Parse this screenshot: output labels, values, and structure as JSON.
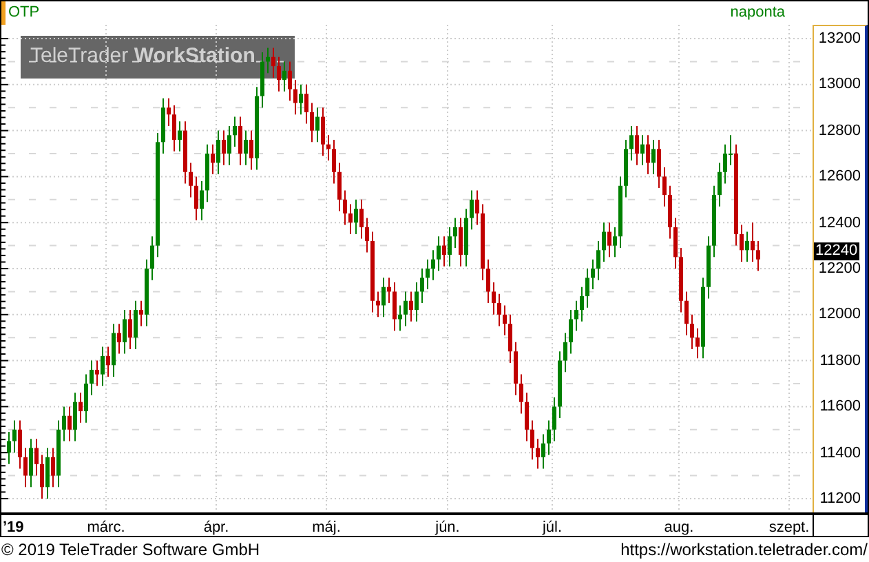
{
  "header": {
    "symbol": "OTP",
    "period": "naponta"
  },
  "watermark": {
    "brand": "TeleTrader",
    "product": "WorkStation"
  },
  "chart": {
    "current_price": "12240",
    "chart_data": {
      "type": "candlestick",
      "grid": true,
      "ylim": [
        11140,
        13260
      ],
      "yticks": [
        13200,
        13000,
        12800,
        12600,
        12400,
        12200,
        12000,
        11800,
        11600,
        11400,
        11200
      ],
      "categories": [
        "’19",
        null,
        null,
        null,
        null,
        null,
        null,
        null,
        null,
        null,
        null,
        null,
        null,
        null,
        null,
        null,
        null,
        null,
        "márc.",
        null,
        null,
        null,
        null,
        null,
        null,
        null,
        null,
        null,
        null,
        null,
        null,
        null,
        null,
        null,
        null,
        null,
        null,
        null,
        "ápr.",
        null,
        null,
        null,
        null,
        null,
        null,
        null,
        null,
        null,
        null,
        null,
        null,
        null,
        null,
        null,
        null,
        null,
        null,
        null,
        "máj.",
        null,
        null,
        null,
        null,
        null,
        null,
        null,
        null,
        null,
        null,
        null,
        null,
        null,
        null,
        null,
        null,
        null,
        null,
        null,
        null,
        null,
        "jún.",
        null,
        null,
        null,
        null,
        null,
        null,
        null,
        null,
        null,
        null,
        null,
        null,
        null,
        null,
        null,
        null,
        null,
        null,
        "júl.",
        null,
        null,
        null,
        null,
        null,
        null,
        null,
        null,
        null,
        null,
        null,
        null,
        null,
        null,
        null,
        null,
        null,
        null,
        null,
        null,
        null,
        null,
        "aug.",
        null,
        null,
        null,
        null,
        null,
        null,
        null,
        null,
        null,
        null,
        null,
        null,
        null,
        null,
        null,
        null,
        null,
        null,
        null,
        "szept."
      ],
      "ohlc": [
        [
          11400,
          11490,
          11350,
          11450
        ],
        [
          11450,
          11540,
          11400,
          11500
        ],
        [
          11500,
          11540,
          11330,
          11380
        ],
        [
          11380,
          11420,
          11250,
          11300
        ],
        [
          11300,
          11460,
          11250,
          11420
        ],
        [
          11420,
          11460,
          11300,
          11350
        ],
        [
          11350,
          11390,
          11200,
          11250
        ],
        [
          11250,
          11420,
          11200,
          11380
        ],
        [
          11380,
          11420,
          11250,
          11300
        ],
        [
          11300,
          11540,
          11250,
          11500
        ],
        [
          11500,
          11600,
          11450,
          11560
        ],
        [
          11560,
          11600,
          11450,
          11500
        ],
        [
          11500,
          11660,
          11450,
          11620
        ],
        [
          11620,
          11660,
          11530,
          11580
        ],
        [
          11580,
          11740,
          11530,
          11700
        ],
        [
          11700,
          11800,
          11650,
          11760
        ],
        [
          11760,
          11800,
          11690,
          11740
        ],
        [
          11740,
          11860,
          11690,
          11820
        ],
        [
          11820,
          11860,
          11730,
          11780
        ],
        [
          11780,
          11960,
          11730,
          11920
        ],
        [
          11920,
          11960,
          11830,
          11880
        ],
        [
          11880,
          12020,
          11830,
          11980
        ],
        [
          11980,
          12020,
          11850,
          11900
        ],
        [
          11900,
          12060,
          11850,
          12020
        ],
        [
          12020,
          12060,
          11950,
          12000
        ],
        [
          12000,
          12240,
          11950,
          12200
        ],
        [
          12200,
          12340,
          12150,
          12300
        ],
        [
          12300,
          12790,
          12250,
          12750
        ],
        [
          12750,
          12940,
          12700,
          12900
        ],
        [
          12900,
          12940,
          12820,
          12870
        ],
        [
          12870,
          12910,
          12710,
          12760
        ],
        [
          12760,
          12840,
          12710,
          12800
        ],
        [
          12800,
          12840,
          12570,
          12620
        ],
        [
          12620,
          12660,
          12510,
          12560
        ],
        [
          12560,
          12600,
          12410,
          12460
        ],
        [
          12460,
          12580,
          12410,
          12540
        ],
        [
          12540,
          12740,
          12490,
          12700
        ],
        [
          12700,
          12740,
          12610,
          12660
        ],
        [
          12660,
          12800,
          12610,
          12760
        ],
        [
          12760,
          12800,
          12650,
          12700
        ],
        [
          12700,
          12820,
          12650,
          12780
        ],
        [
          12780,
          12860,
          12730,
          12820
        ],
        [
          12820,
          12860,
          12650,
          12700
        ],
        [
          12700,
          12800,
          12650,
          12760
        ],
        [
          12760,
          12800,
          12630,
          12680
        ],
        [
          12680,
          12990,
          12630,
          12950
        ],
        [
          12950,
          13140,
          12900,
          13100
        ],
        [
          13100,
          13160,
          13050,
          13120
        ],
        [
          13120,
          13160,
          13030,
          13080
        ],
        [
          13080,
          13120,
          12970,
          13020
        ],
        [
          13020,
          13100,
          12970,
          13060
        ],
        [
          13060,
          13100,
          12930,
          12980
        ],
        [
          12980,
          13020,
          12870,
          12920
        ],
        [
          12920,
          13000,
          12870,
          12960
        ],
        [
          12960,
          13000,
          12830,
          12880
        ],
        [
          12880,
          12920,
          12750,
          12800
        ],
        [
          12800,
          12900,
          12750,
          12860
        ],
        [
          12860,
          12900,
          12690,
          12740
        ],
        [
          12740,
          12780,
          12670,
          12720
        ],
        [
          12720,
          12760,
          12570,
          12620
        ],
        [
          12620,
          12660,
          12450,
          12500
        ],
        [
          12500,
          12540,
          12390,
          12440
        ],
        [
          12440,
          12480,
          12350,
          12400
        ],
        [
          12400,
          12500,
          12350,
          12460
        ],
        [
          12460,
          12500,
          12330,
          12380
        ],
        [
          12380,
          12420,
          12270,
          12320
        ],
        [
          12320,
          12360,
          12010,
          12060
        ],
        [
          12060,
          12100,
          11990,
          12040
        ],
        [
          12040,
          12160,
          11990,
          12120
        ],
        [
          12120,
          12160,
          12050,
          12100
        ],
        [
          12100,
          12140,
          11930,
          11980
        ],
        [
          11980,
          12040,
          11930,
          12000
        ],
        [
          12000,
          12100,
          11950,
          12060
        ],
        [
          12060,
          12100,
          11970,
          12020
        ],
        [
          12020,
          12140,
          11970,
          12100
        ],
        [
          12100,
          12200,
          12050,
          12160
        ],
        [
          12160,
          12240,
          12110,
          12200
        ],
        [
          12200,
          12280,
          12150,
          12240
        ],
        [
          12240,
          12340,
          12190,
          12300
        ],
        [
          12300,
          12340,
          12210,
          12260
        ],
        [
          12260,
          12380,
          12210,
          12340
        ],
        [
          12340,
          12420,
          12290,
          12380
        ],
        [
          12380,
          12420,
          12210,
          12260
        ],
        [
          12260,
          12460,
          12210,
          12420
        ],
        [
          12420,
          12540,
          12370,
          12500
        ],
        [
          12500,
          12540,
          12390,
          12440
        ],
        [
          12440,
          12480,
          12150,
          12200
        ],
        [
          12200,
          12240,
          12050,
          12100
        ],
        [
          12100,
          12140,
          12000,
          12050
        ],
        [
          12050,
          12090,
          11950,
          12000
        ],
        [
          12000,
          12040,
          11910,
          11960
        ],
        [
          11960,
          12000,
          11790,
          11840
        ],
        [
          11840,
          11880,
          11650,
          11700
        ],
        [
          11700,
          11740,
          11570,
          11620
        ],
        [
          11620,
          11660,
          11450,
          11500
        ],
        [
          11500,
          11540,
          11370,
          11420
        ],
        [
          11420,
          11460,
          11330,
          11380
        ],
        [
          11380,
          11480,
          11330,
          11440
        ],
        [
          11440,
          11540,
          11390,
          11500
        ],
        [
          11500,
          11640,
          11450,
          11600
        ],
        [
          11600,
          11840,
          11550,
          11800
        ],
        [
          11800,
          11920,
          11750,
          11880
        ],
        [
          11880,
          12020,
          11830,
          11980
        ],
        [
          11980,
          12060,
          11930,
          12020
        ],
        [
          12020,
          12120,
          11970,
          12080
        ],
        [
          12080,
          12200,
          12030,
          12160
        ],
        [
          12160,
          12240,
          12110,
          12200
        ],
        [
          12200,
          12320,
          12150,
          12280
        ],
        [
          12280,
          12400,
          12230,
          12360
        ],
        [
          12360,
          12400,
          12250,
          12300
        ],
        [
          12300,
          12380,
          12250,
          12340
        ],
        [
          12340,
          12600,
          12290,
          12560
        ],
        [
          12560,
          12760,
          12510,
          12720
        ],
        [
          12720,
          12820,
          12670,
          12780
        ],
        [
          12780,
          12820,
          12650,
          12700
        ],
        [
          12700,
          12780,
          12650,
          12740
        ],
        [
          12740,
          12780,
          12610,
          12660
        ],
        [
          12660,
          12760,
          12610,
          12720
        ],
        [
          12720,
          12760,
          12550,
          12600
        ],
        [
          12600,
          12640,
          12470,
          12520
        ],
        [
          12520,
          12560,
          12330,
          12380
        ],
        [
          12380,
          12420,
          12200,
          12250
        ],
        [
          12250,
          12290,
          12010,
          12060
        ],
        [
          12060,
          12100,
          11910,
          11960
        ],
        [
          11960,
          12000,
          11850,
          11900
        ],
        [
          11900,
          11940,
          11810,
          11860
        ],
        [
          11860,
          12160,
          11810,
          12120
        ],
        [
          12120,
          12340,
          12070,
          12300
        ],
        [
          12300,
          12560,
          12250,
          12520
        ],
        [
          12520,
          12660,
          12470,
          12620
        ],
        [
          12620,
          12740,
          12570,
          12700
        ],
        [
          12700,
          12780,
          12650,
          12700
        ],
        [
          12700,
          12740,
          12300,
          12350
        ],
        [
          12350,
          12390,
          12230,
          12280
        ],
        [
          12280,
          12360,
          12230,
          12320
        ],
        [
          12320,
          12400,
          12230,
          12280
        ],
        [
          12280,
          12320,
          12190,
          12240
        ],
        null,
        null,
        null,
        null,
        null,
        null
      ]
    }
  },
  "footer": {
    "copyright": "© 2019 TeleTrader Software GmbH",
    "url": "https://workstation.teletrader.com/"
  }
}
